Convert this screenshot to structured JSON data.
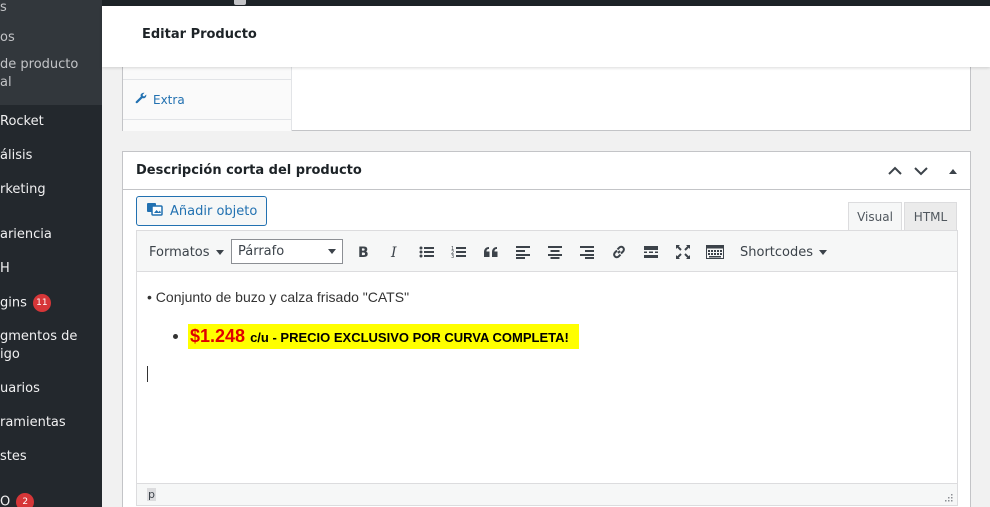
{
  "sidebar": {
    "submenu": [
      "s",
      "os",
      "de producto",
      "al"
    ],
    "items": [
      {
        "label": "Rocket"
      },
      {
        "label": "álisis"
      },
      {
        "label": "rketing"
      },
      {
        "label": "ariencia"
      },
      {
        "label": "H"
      },
      {
        "label": "gins",
        "badge": "11"
      },
      {
        "label": "gmentos de"
      },
      {
        "label": "igo"
      },
      {
        "label": "uarios"
      },
      {
        "label": "ramientas"
      },
      {
        "label": "stes"
      },
      {
        "label": "O",
        "badge": "2"
      }
    ]
  },
  "header": {
    "title": "Editar Producto"
  },
  "product_data": {
    "extra_tab": "Extra"
  },
  "short_description": {
    "title": "Descripción corta del producto",
    "add_media": "Añadir objeto",
    "tabs": {
      "visual": "Visual",
      "html": "HTML"
    },
    "toolbar": {
      "formats": "Formatos",
      "paragraph": "Párrafo",
      "shortcodes": "Shortcodes"
    },
    "content": {
      "line1": "• Conjunto de buzo y calza frisado \"CATS\"",
      "price": "$1.248",
      "price_text": "c/u - PRECIO EXCLUSIVO POR CURVA COMPLETA!"
    },
    "status_path": "p"
  },
  "colors": {
    "highlight": "#ffff00",
    "price": "#e00000",
    "link": "#2271b1",
    "sidebar": "#23282d"
  }
}
